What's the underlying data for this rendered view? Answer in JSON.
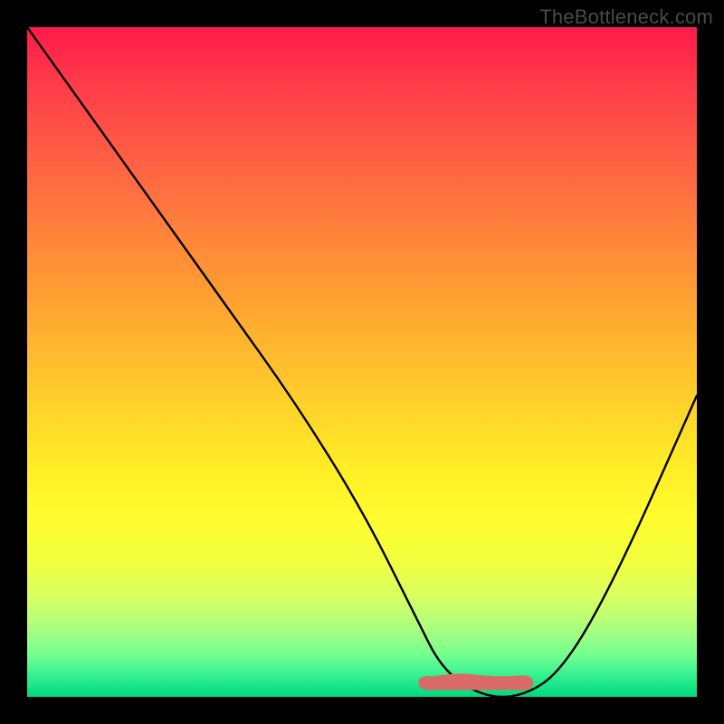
{
  "watermark": "TheBottleneck.com",
  "chart_data": {
    "type": "line",
    "title": "",
    "xlabel": "",
    "ylabel": "",
    "xlim": [
      0,
      100
    ],
    "ylim": [
      0,
      100
    ],
    "series": [
      {
        "name": "bottleneck-curve",
        "x": [
          0,
          10,
          20,
          30,
          40,
          50,
          58,
          62,
          68,
          74,
          80,
          88,
          100
        ],
        "values": [
          100,
          86,
          72,
          58,
          44,
          28,
          12,
          4,
          0,
          0,
          4,
          18,
          45
        ]
      }
    ],
    "annotations": [
      {
        "name": "optimal-zone",
        "x_start": 60,
        "x_end": 74,
        "y": 0
      }
    ]
  },
  "colors": {
    "curve": "#000000",
    "marker": "#d96a66",
    "background_top": "#ff1a4a",
    "background_bottom": "#00d880"
  }
}
